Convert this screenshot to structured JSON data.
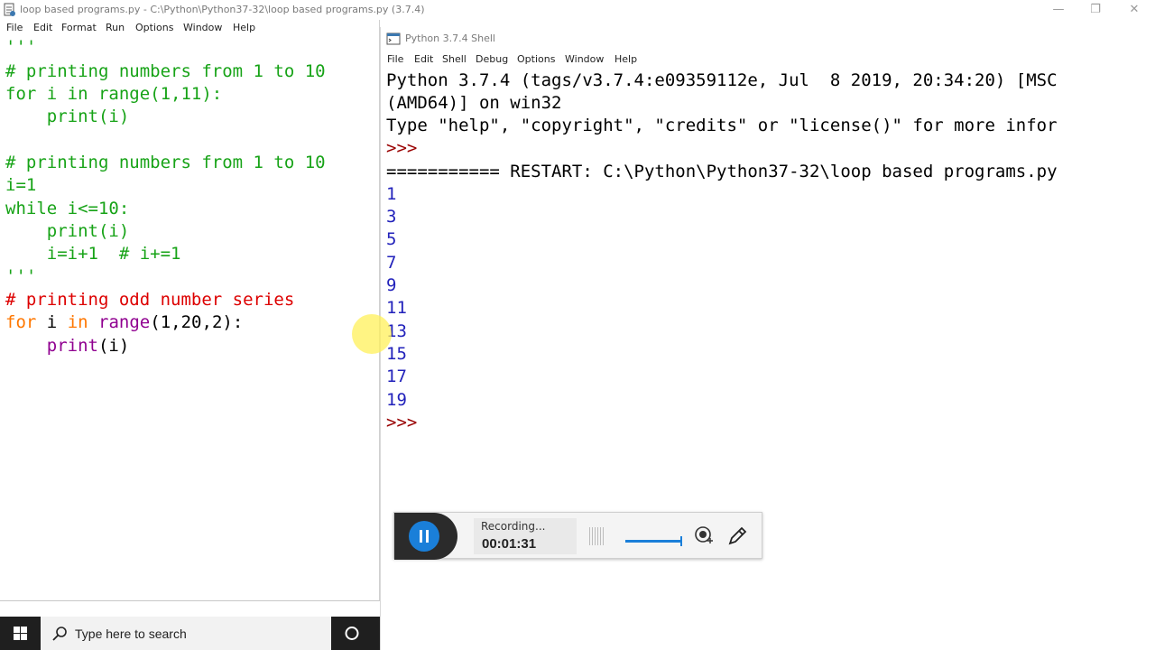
{
  "editor": {
    "title": "loop based programs.py - C:\\Python\\Python37-32\\loop based programs.py (3.7.4)",
    "menu": [
      "File",
      "Edit",
      "Format",
      "Run",
      "Options",
      "Window",
      "Help"
    ],
    "code_lines": [
      "'''",
      "# printing numbers from 1 to 10",
      "for i in range(1,11):",
      "    print(i)",
      "",
      "# printing numbers from 1 to 10",
      "i=1",
      "while i<=10:",
      "    print(i)",
      "    i=i+1  # i+=1",
      "'''",
      "# printing odd number series",
      "for i in range(1,20,2):",
      "    print(i)"
    ]
  },
  "window_controls": {
    "minimize": "—",
    "restore": "❐",
    "close": "✕"
  },
  "shell": {
    "title": "Python 3.7.4 Shell",
    "menu": [
      "File",
      "Edit",
      "Shell",
      "Debug",
      "Options",
      "Window",
      "Help"
    ],
    "banner_1": "Python 3.7.4 (tags/v3.7.4:e09359112e, Jul  8 2019, 20:34:20) [MSC",
    "banner_2": "(AMD64)] on win32",
    "banner_3": "Type \"help\", \"copyright\", \"credits\" or \"license()\" for more infor",
    "prompt": ">>>",
    "restart_line": "=========== RESTART: C:\\Python\\Python37-32\\loop based programs.py",
    "outputs": [
      "1",
      "3",
      "5",
      "7",
      "9",
      "11",
      "13",
      "15",
      "17",
      "19"
    ],
    "final_prompt": ">>>"
  },
  "recorder": {
    "status": "Recording...",
    "elapsed": "00:01:31",
    "volume_level": 1.0
  },
  "taskbar": {
    "search_placeholder": "Type here to search"
  },
  "colors": {
    "comment": "#dd0000",
    "keyword": "#ff7700",
    "builtin": "#900090",
    "docstring": "#17a317",
    "output": "#2222bb",
    "accent": "#1a7fd9"
  },
  "icons": [
    "python-idle-icon",
    "windows-start-icon",
    "search-icon",
    "cortana-icon",
    "pause-icon",
    "webcam-icon",
    "pen-icon"
  ]
}
